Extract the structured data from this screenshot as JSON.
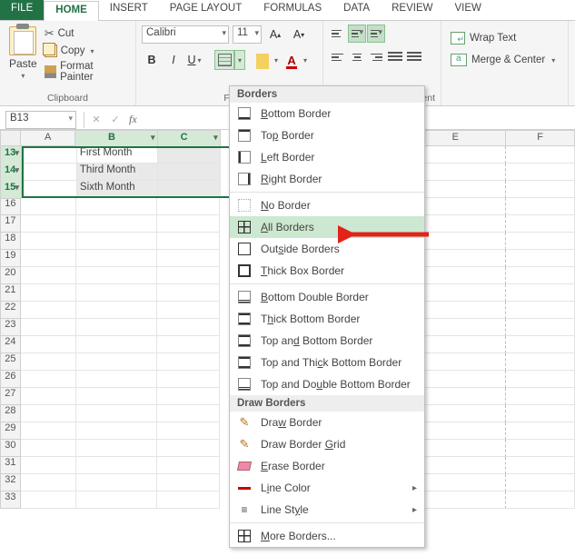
{
  "tabs": {
    "file": "FILE",
    "home": "HOME",
    "insert": "INSERT",
    "pagelayout": "PAGE LAYOUT",
    "formulas": "FORMULAS",
    "data": "DATA",
    "review": "REVIEW",
    "view": "VIEW"
  },
  "clipboard": {
    "paste": "Paste",
    "cut": "Cut",
    "copy": "Copy",
    "format_painter": "Format Painter",
    "group": "Clipboard"
  },
  "font": {
    "name": "Calibri",
    "size": "11",
    "group_partial": "Fo"
  },
  "alignment": {
    "wrap": "Wrap Text",
    "merge": "Merge & Center",
    "group_partial": "lignment"
  },
  "namebox": "B13",
  "fx": "fx",
  "cells": {
    "b13": "First Month",
    "b14": "Third Month",
    "b15": "Sixth Month"
  },
  "row_numbers": [
    "13",
    "14",
    "15",
    "16",
    "17",
    "18",
    "19",
    "20",
    "21",
    "22",
    "23",
    "24",
    "25",
    "26",
    "27",
    "28",
    "29",
    "30",
    "31",
    "32",
    "33"
  ],
  "col_letters": {
    "a": "A",
    "b": "B",
    "c": "C",
    "e": "E",
    "f": "F"
  },
  "borders_menu": {
    "header1": "Borders",
    "bottom": "Bottom Border",
    "top": "Top Border",
    "left": "Left Border",
    "right": "Right Border",
    "none": "No Border",
    "all": "All Borders",
    "outside": "Outside Borders",
    "thick": "Thick Box Border",
    "bdouble": "Bottom Double Border",
    "tbottom": "Thick Bottom Border",
    "tandb": "Top and Bottom Border",
    "tandtb": "Top and Thick Bottom Border",
    "tanddb": "Top and Double Bottom Border",
    "header2": "Draw Borders",
    "draw": "Draw Border",
    "drawgrid": "Draw Border Grid",
    "erase": "Erase Border",
    "linecolor": "Line Color",
    "linestyle": "Line Style",
    "more": "More Borders..."
  }
}
